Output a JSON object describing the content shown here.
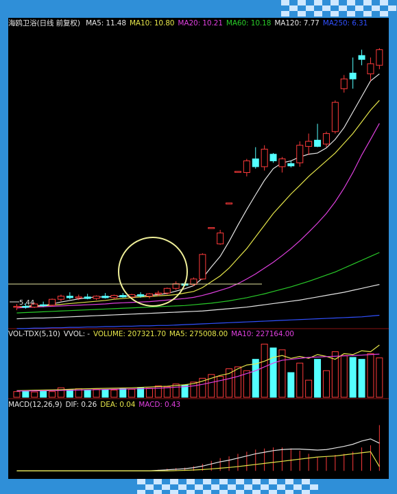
{
  "colors": {
    "background": "#000000",
    "frame": "#2f8fd8",
    "divider": "#8a1414",
    "up": "#ff3b3b",
    "down": "#54ffff",
    "white": "#e6e6e6",
    "yellow": "#e6e64a",
    "magenta": "#e040e0",
    "green": "#29cc29",
    "blue": "#3050ff",
    "circle": "#f0f09a"
  },
  "price_panel": {
    "stock_name": "海鸥卫浴(日线 前复权)",
    "legend": [
      {
        "key": "ma5",
        "label": "MA5: 11.48",
        "color": "#e6e6e6"
      },
      {
        "key": "ma10",
        "label": "MA10: 10.80",
        "color": "#e6e64a"
      },
      {
        "key": "ma20",
        "label": "MA20: 10.21",
        "color": "#e040e0"
      },
      {
        "key": "ma60",
        "label": "MA60: 10.18",
        "color": "#29cc29"
      },
      {
        "key": "ma120",
        "label": "MA120: 7.77",
        "color": "#e6e6e6"
      },
      {
        "key": "ma250",
        "label": "MA250: 6.31",
        "color": "#3050ff"
      }
    ],
    "low_marker": "5.44"
  },
  "volume_panel": {
    "legend": [
      {
        "key": "indicator",
        "label": "VOL-TDX(5,10)",
        "color": "#e6e6e6"
      },
      {
        "key": "vvol",
        "label": "VVOL: -",
        "color": "#e6e6e6"
      },
      {
        "key": "volume",
        "label": "VOLUME: 207321.70",
        "color": "#e6e64a"
      },
      {
        "key": "ma5",
        "label": "MA5: 275008.00",
        "color": "#e6e64a"
      },
      {
        "key": "ma10",
        "label": "MA10: 227164.00",
        "color": "#e040e0"
      }
    ]
  },
  "macd_panel": {
    "legend": [
      {
        "key": "indicator",
        "label": "MACD(12,26,9)",
        "color": "#e6e6e6"
      },
      {
        "key": "dif",
        "label": "DIF: 0.26",
        "color": "#e6e6e6"
      },
      {
        "key": "dea",
        "label": "DEA: 0.04",
        "color": "#e6e64a"
      },
      {
        "key": "macd",
        "label": "MACD: 0.43",
        "color": "#e040e0"
      }
    ]
  },
  "chart_data": [
    {
      "type": "candlestick",
      "title": "海鸥卫浴(日线 前复权)",
      "ylim": [
        5.0,
        12.6
      ],
      "ohlc": [
        [
          5.5,
          5.58,
          5.42,
          5.52
        ],
        [
          5.52,
          5.6,
          5.46,
          5.5
        ],
        [
          5.5,
          5.62,
          5.48,
          5.58
        ],
        [
          5.56,
          5.64,
          5.5,
          5.54
        ],
        [
          5.55,
          5.72,
          5.52,
          5.7
        ],
        [
          5.7,
          5.82,
          5.65,
          5.78
        ],
        [
          5.78,
          5.88,
          5.7,
          5.74
        ],
        [
          5.74,
          5.82,
          5.68,
          5.76
        ],
        [
          5.76,
          5.84,
          5.7,
          5.72
        ],
        [
          5.72,
          5.8,
          5.68,
          5.78
        ],
        [
          5.78,
          5.86,
          5.72,
          5.74
        ],
        [
          5.74,
          5.82,
          5.7,
          5.8
        ],
        [
          5.8,
          5.86,
          5.74,
          5.76
        ],
        [
          5.76,
          5.84,
          5.72,
          5.82
        ],
        [
          5.82,
          5.88,
          5.74,
          5.78
        ],
        [
          5.78,
          5.86,
          5.72,
          5.84
        ],
        [
          5.84,
          5.92,
          5.78,
          5.86
        ],
        [
          5.86,
          6.0,
          5.82,
          5.98
        ],
        [
          5.98,
          6.16,
          5.94,
          6.1
        ],
        [
          6.1,
          6.14,
          6.04,
          6.06
        ],
        [
          6.08,
          6.26,
          6.04,
          6.22
        ],
        [
          6.22,
          6.88,
          6.2,
          6.85
        ],
        [
          7.54,
          7.54,
          7.54,
          7.54
        ],
        [
          7.12,
          7.48,
          7.1,
          7.4
        ],
        [
          8.17,
          8.17,
          8.17,
          8.17
        ],
        [
          8.98,
          8.98,
          8.98,
          8.98
        ],
        [
          8.95,
          9.3,
          8.85,
          9.25
        ],
        [
          9.3,
          9.6,
          9.05,
          9.1
        ],
        [
          9.1,
          9.65,
          9.0,
          9.55
        ],
        [
          9.42,
          9.45,
          9.2,
          9.25
        ],
        [
          9.1,
          9.35,
          8.95,
          9.3
        ],
        [
          9.18,
          9.25,
          9.08,
          9.12
        ],
        [
          9.2,
          9.75,
          9.1,
          9.65
        ],
        [
          9.62,
          9.95,
          9.4,
          9.75
        ],
        [
          9.78,
          10.2,
          9.6,
          9.62
        ],
        [
          9.68,
          10.0,
          9.6,
          9.95
        ],
        [
          10.0,
          10.8,
          9.95,
          10.75
        ],
        [
          11.1,
          11.45,
          11.0,
          11.35
        ],
        [
          11.5,
          11.9,
          11.1,
          11.35
        ],
        [
          11.95,
          12.1,
          11.7,
          11.85
        ],
        [
          11.48,
          11.9,
          11.3,
          11.74
        ],
        [
          11.7,
          12.14,
          11.6,
          12.1
        ]
      ],
      "moving_averages": {
        "MA5": [
          5.5,
          5.52,
          5.54,
          5.54,
          5.58,
          5.63,
          5.67,
          5.71,
          5.74,
          5.76,
          5.76,
          5.77,
          5.78,
          5.78,
          5.79,
          5.8,
          5.82,
          5.85,
          5.91,
          5.97,
          6.05,
          6.24,
          6.53,
          6.8,
          7.18,
          7.6,
          8.0,
          8.38,
          8.75,
          9.05,
          9.2,
          9.25,
          9.35,
          9.42,
          9.45,
          9.58,
          9.8,
          10.1,
          10.5,
          10.9,
          11.3,
          11.48
        ],
        "MA10": [
          5.5,
          5.51,
          5.52,
          5.53,
          5.55,
          5.57,
          5.59,
          5.61,
          5.63,
          5.65,
          5.67,
          5.7,
          5.72,
          5.74,
          5.76,
          5.77,
          5.79,
          5.8,
          5.82,
          5.86,
          5.9,
          6.0,
          6.15,
          6.3,
          6.5,
          6.75,
          7.0,
          7.3,
          7.6,
          7.9,
          8.15,
          8.4,
          8.62,
          8.85,
          9.05,
          9.25,
          9.45,
          9.7,
          9.95,
          10.25,
          10.55,
          10.8
        ],
        "MA20": [
          5.48,
          5.49,
          5.5,
          5.51,
          5.52,
          5.53,
          5.54,
          5.55,
          5.56,
          5.57,
          5.58,
          5.6,
          5.61,
          5.62,
          5.63,
          5.64,
          5.66,
          5.68,
          5.7,
          5.72,
          5.75,
          5.8,
          5.86,
          5.93,
          6.0,
          6.1,
          6.22,
          6.35,
          6.5,
          6.65,
          6.82,
          7.0,
          7.2,
          7.42,
          7.65,
          7.9,
          8.2,
          8.55,
          8.95,
          9.4,
          9.8,
          10.21
        ],
        "MA60": [
          5.35,
          5.36,
          5.37,
          5.38,
          5.39,
          5.4,
          5.41,
          5.42,
          5.43,
          5.44,
          5.45,
          5.46,
          5.47,
          5.48,
          5.49,
          5.5,
          5.51,
          5.52,
          5.53,
          5.54,
          5.56,
          5.58,
          5.6,
          5.63,
          5.66,
          5.7,
          5.74,
          5.79,
          5.84,
          5.9,
          5.96,
          6.02,
          6.09,
          6.16,
          6.24,
          6.32,
          6.4,
          6.5,
          6.6,
          6.7,
          6.8,
          6.9
        ],
        "MA120": [
          5.2,
          5.21,
          5.22,
          5.22,
          5.23,
          5.24,
          5.25,
          5.26,
          5.27,
          5.28,
          5.29,
          5.3,
          5.31,
          5.32,
          5.33,
          5.34,
          5.35,
          5.36,
          5.37,
          5.38,
          5.39,
          5.4,
          5.42,
          5.44,
          5.46,
          5.48,
          5.5,
          5.53,
          5.56,
          5.59,
          5.62,
          5.65,
          5.68,
          5.72,
          5.76,
          5.8,
          5.84,
          5.88,
          5.93,
          5.98,
          6.03,
          6.08
        ],
        "MA250": [
          4.95,
          4.95,
          4.96,
          4.96,
          4.97,
          4.97,
          4.98,
          4.98,
          4.99,
          4.99,
          5.0,
          5.0,
          5.01,
          5.01,
          5.02,
          5.02,
          5.03,
          5.03,
          5.04,
          5.05,
          5.06,
          5.07,
          5.08,
          5.09,
          5.1,
          5.11,
          5.12,
          5.13,
          5.14,
          5.15,
          5.16,
          5.17,
          5.18,
          5.19,
          5.2,
          5.21,
          5.22,
          5.23,
          5.24,
          5.25,
          5.27,
          5.29
        ]
      }
    },
    {
      "type": "bar",
      "title": "VOL-TDX(5,10)",
      "ylim": [
        0,
        300000
      ],
      "volumes": [
        30000,
        35000,
        28000,
        32000,
        30000,
        50000,
        40000,
        45000,
        38000,
        42000,
        40000,
        38000,
        45000,
        42000,
        50000,
        48000,
        60000,
        55000,
        70000,
        65000,
        80000,
        100000,
        120000,
        110000,
        150000,
        160000,
        140000,
        200000,
        280000,
        260000,
        250000,
        130000,
        180000,
        90000,
        200000,
        140000,
        240000,
        220000,
        210000,
        200000,
        230000,
        207321.7
      ],
      "ma5": [
        35000,
        36000,
        37000,
        38000,
        39000,
        40000,
        42000,
        44000,
        45000,
        46000,
        47000,
        48000,
        49000,
        50000,
        52000,
        54000,
        56000,
        58000,
        62000,
        66000,
        72000,
        85000,
        100000,
        115000,
        125000,
        150000,
        170000,
        175000,
        190000,
        210000,
        220000,
        205000,
        215000,
        205000,
        225000,
        215000,
        200000,
        230000,
        225000,
        245000,
        240000,
        275008
      ],
      "ma10": [
        33000,
        33500,
        34000,
        34500,
        35000,
        36000,
        37000,
        38000,
        39000,
        40000,
        41000,
        42000,
        43000,
        44000,
        45000,
        46000,
        48000,
        50000,
        53000,
        56000,
        60000,
        68000,
        78000,
        88000,
        98000,
        110000,
        125000,
        140000,
        160000,
        180000,
        195000,
        200000,
        205000,
        210000,
        212000,
        214000,
        216000,
        218000,
        220000,
        222000,
        225000,
        227164
      ]
    },
    {
      "type": "line",
      "title": "MACD(12,26,9)",
      "ylim": [
        -0.05,
        0.55
      ],
      "dif": [
        0.0,
        0.0,
        0.0,
        0.0,
        0.0,
        0.0,
        0.0,
        0.0,
        0.0,
        0.0,
        0.0,
        0.0,
        0.0,
        0.0,
        0.0,
        0.0,
        0.005,
        0.01,
        0.015,
        0.02,
        0.03,
        0.045,
        0.065,
        0.085,
        0.1,
        0.12,
        0.14,
        0.16,
        0.175,
        0.19,
        0.2,
        0.205,
        0.205,
        0.2,
        0.195,
        0.2,
        0.215,
        0.23,
        0.25,
        0.28,
        0.3,
        0.26
      ],
      "dea": [
        0.0,
        0.0,
        0.0,
        0.0,
        0.0,
        0.0,
        0.0,
        0.0,
        0.0,
        0.0,
        0.0,
        0.0,
        0.0,
        0.0,
        0.0,
        0.0,
        0.0,
        0.0,
        0.002,
        0.005,
        0.008,
        0.012,
        0.018,
        0.025,
        0.032,
        0.04,
        0.05,
        0.06,
        0.07,
        0.08,
        0.09,
        0.1,
        0.11,
        0.12,
        0.13,
        0.135,
        0.14,
        0.15,
        0.16,
        0.17,
        0.18,
        0.04
      ],
      "macd": [
        0.0,
        0.0,
        0.0,
        0.0,
        0.0,
        0.0,
        0.0,
        0.0,
        0.0,
        0.0,
        0.0,
        0.0,
        0.0,
        0.0,
        0.0,
        0.0,
        0.01,
        0.02,
        0.026,
        0.03,
        0.044,
        0.066,
        0.094,
        0.12,
        0.136,
        0.16,
        0.18,
        0.2,
        0.21,
        0.22,
        0.22,
        0.21,
        0.19,
        0.16,
        0.13,
        0.13,
        0.15,
        0.16,
        0.18,
        0.22,
        0.24,
        0.43
      ]
    }
  ]
}
